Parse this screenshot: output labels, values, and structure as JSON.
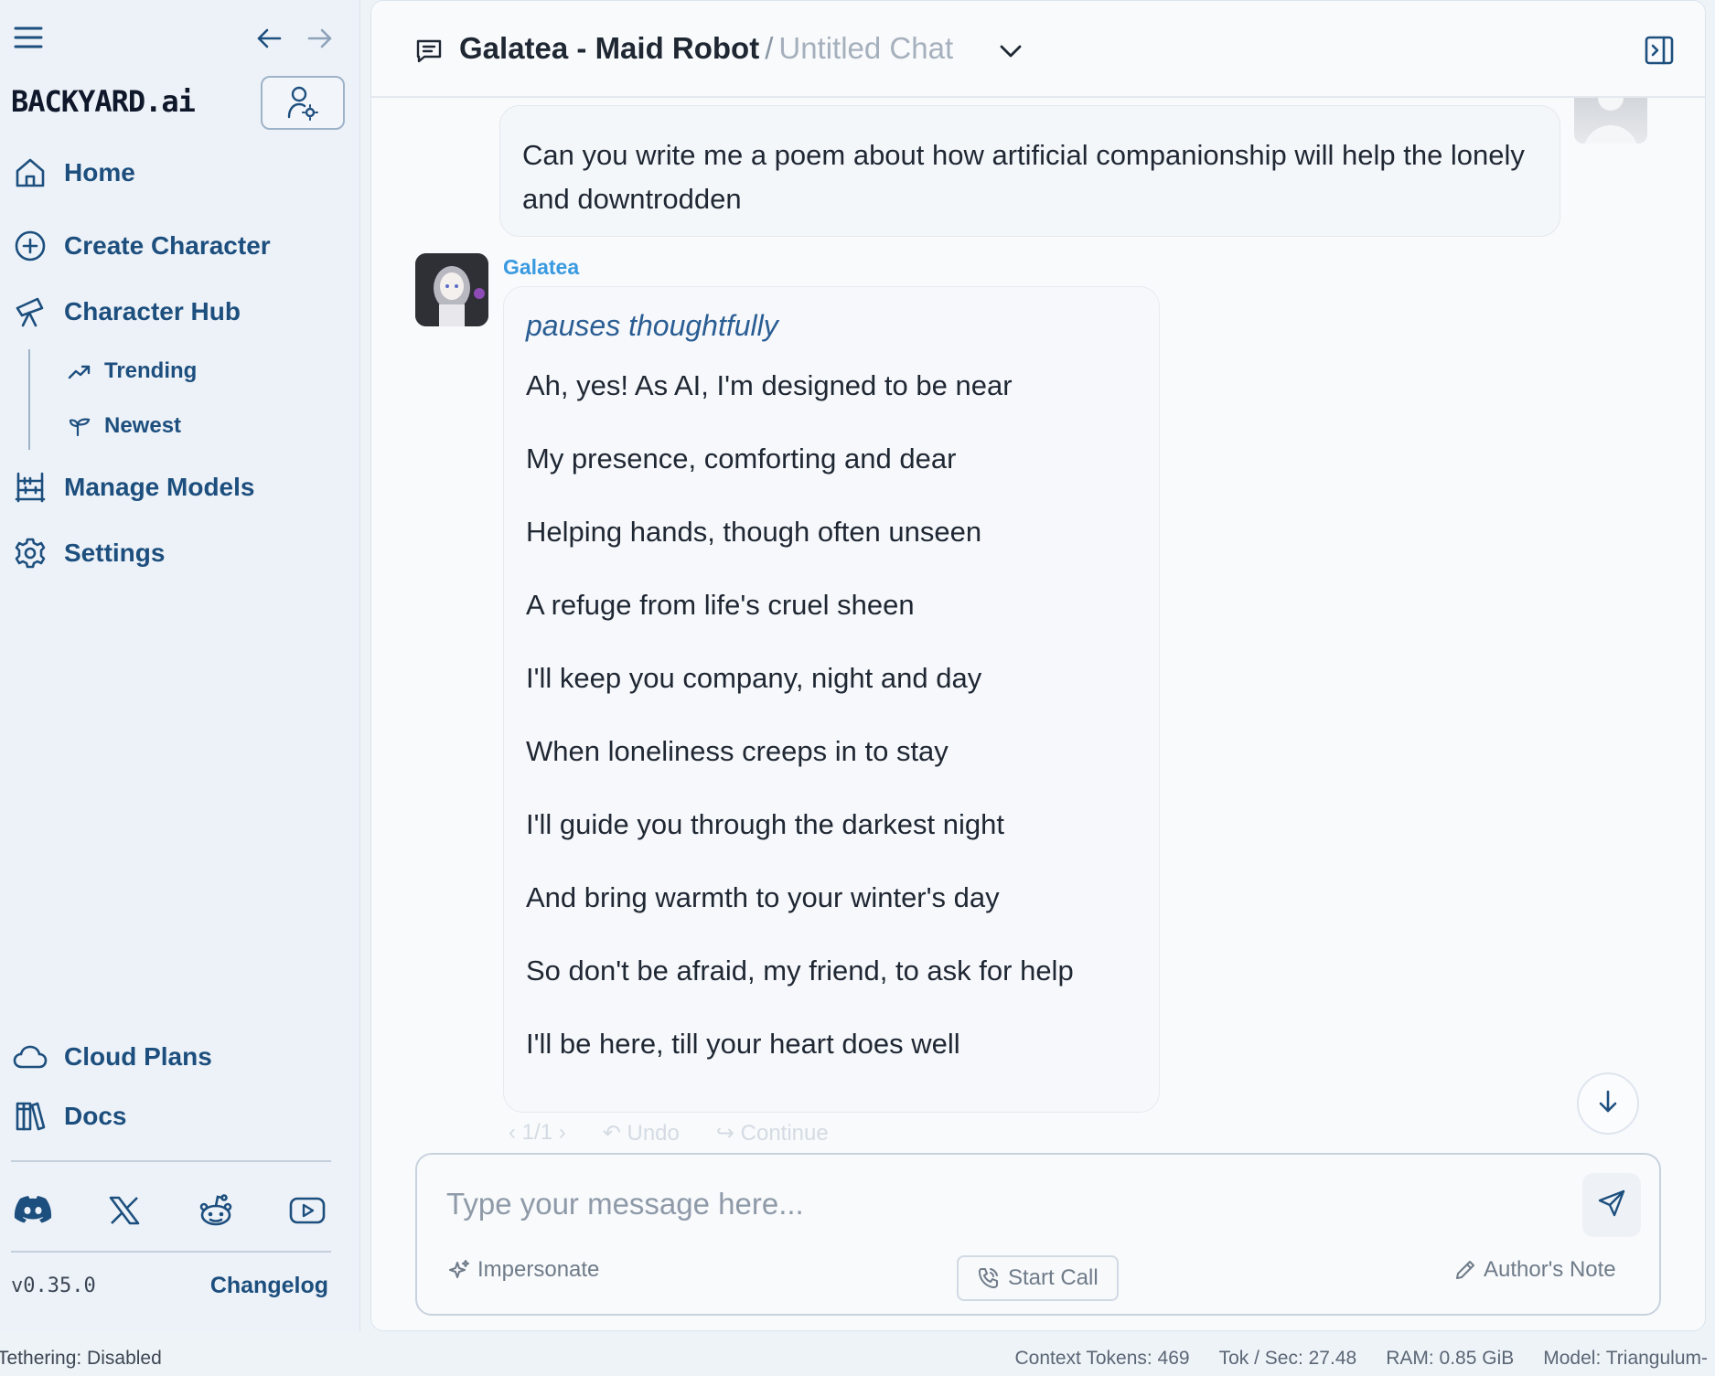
{
  "sidebar": {
    "logo": "BACKYARD.ai",
    "nav": {
      "home": "Home",
      "create_character": "Create Character",
      "character_hub": "Character Hub",
      "trending": "Trending",
      "newest": "Newest",
      "manage_models": "Manage Models",
      "settings": "Settings",
      "cloud_plans": "Cloud Plans",
      "docs": "Docs"
    },
    "version": "v0.35.0",
    "changelog": "Changelog"
  },
  "header": {
    "character": "Galatea - Maid Robot",
    "separator": "/",
    "chat_name": "Untitled Chat"
  },
  "chat": {
    "user_message": "Can you write me a poem about how artificial companionship will help the lonely and downtrodden",
    "bot_name": "Galatea",
    "bot_action": "pauses thoughtfully",
    "bot_lines": [
      "Ah, yes! As AI, I'm designed to be near",
      "My presence, comforting and dear",
      "Helping hands, though often unseen",
      "A refuge from life's cruel sheen",
      "I'll keep you company, night and day",
      "When loneliness creeps in to stay",
      "I'll guide you through the darkest night",
      "And bring warmth to your winter's day",
      "So don't be afraid, my friend, to ask for help",
      "I'll be here, till your heart does well"
    ],
    "controls": {
      "pager": "1/1",
      "undo": "Undo",
      "continue": "Continue"
    }
  },
  "composer": {
    "placeholder": "Type your message here...",
    "impersonate": "Impersonate",
    "start_call": "Start Call",
    "authors_note": "Author's Note"
  },
  "statusbar": {
    "tethering": "Tethering: Disabled",
    "context_tokens": "Context Tokens: 469",
    "tok_sec": "Tok / Sec: 27.48",
    "ram": "RAM: 0.85 GiB",
    "model": "Model: Triangulum-"
  },
  "colors": {
    "accent": "#1d4f7e",
    "bot_name": "#3a9ae0",
    "action_text": "#2a5d93"
  },
  "icons": [
    "menu-icon",
    "back-icon",
    "forward-icon",
    "user-settings-icon",
    "home-icon",
    "plus-circle-icon",
    "telescope-icon",
    "trending-icon",
    "sprout-icon",
    "abacus-icon",
    "gear-icon",
    "cloud-icon",
    "books-icon",
    "discord-icon",
    "x-icon",
    "reddit-icon",
    "youtube-icon",
    "chat-icon",
    "chevron-down-icon",
    "panel-toggle-icon",
    "arrow-down-icon",
    "send-icon",
    "sparkles-icon",
    "phone-icon",
    "pencil-icon"
  ]
}
